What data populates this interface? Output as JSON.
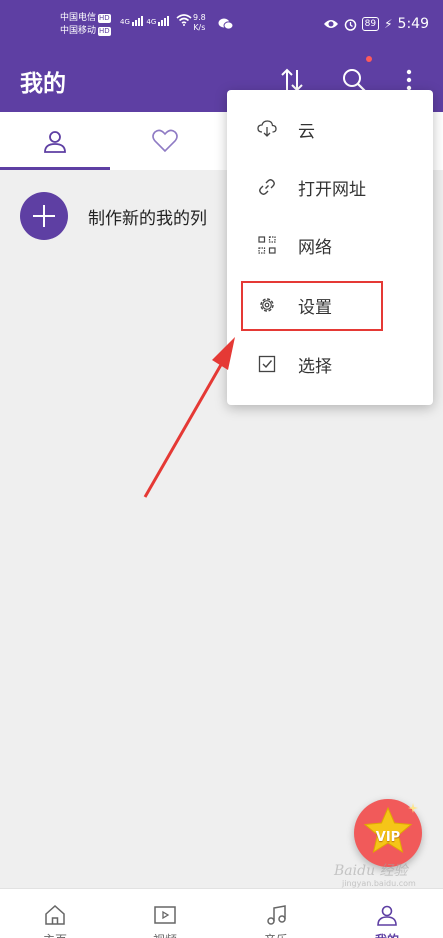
{
  "status_bar": {
    "carrier_1": "中国电信",
    "carrier_2": "中国移动",
    "hd_badge": "HD",
    "network_type": "4G",
    "speed_value": "9.8",
    "speed_unit": "K/s",
    "battery": "89",
    "time": "5:49"
  },
  "app_bar": {
    "title": "我的",
    "icons": [
      "sort-icon",
      "search-icon",
      "more-vert-icon"
    ]
  },
  "tabs": [
    {
      "icon": "person-icon",
      "selected": true
    },
    {
      "icon": "heart-icon",
      "selected": false
    }
  ],
  "main": {
    "new_list_label": "制作新的我的列"
  },
  "menu": {
    "items": [
      {
        "label": "云",
        "icon": "cloud-download-icon"
      },
      {
        "label": "打开网址",
        "icon": "link-icon"
      },
      {
        "label": "网络",
        "icon": "network-icon"
      },
      {
        "label": "设置",
        "icon": "gear-icon",
        "highlighted": true
      },
      {
        "label": "选择",
        "icon": "checkbox-icon"
      }
    ]
  },
  "vip_badge": "VIP",
  "bottom_nav": {
    "items": [
      {
        "label": "主页",
        "icon": "home-icon",
        "active": false
      },
      {
        "label": "视频",
        "icon": "video-icon",
        "active": false
      },
      {
        "label": "音乐",
        "icon": "music-icon",
        "active": false
      },
      {
        "label": "我的",
        "icon": "person-icon",
        "active": true
      }
    ]
  },
  "watermark": {
    "main": "Baidu 经验",
    "sub": "jingyan.baidu.com"
  },
  "colors": {
    "primary": "#5e3fa3",
    "annotation_red": "#e53935",
    "vip_background": "#f15a5a",
    "vip_star": "#f5c518"
  }
}
